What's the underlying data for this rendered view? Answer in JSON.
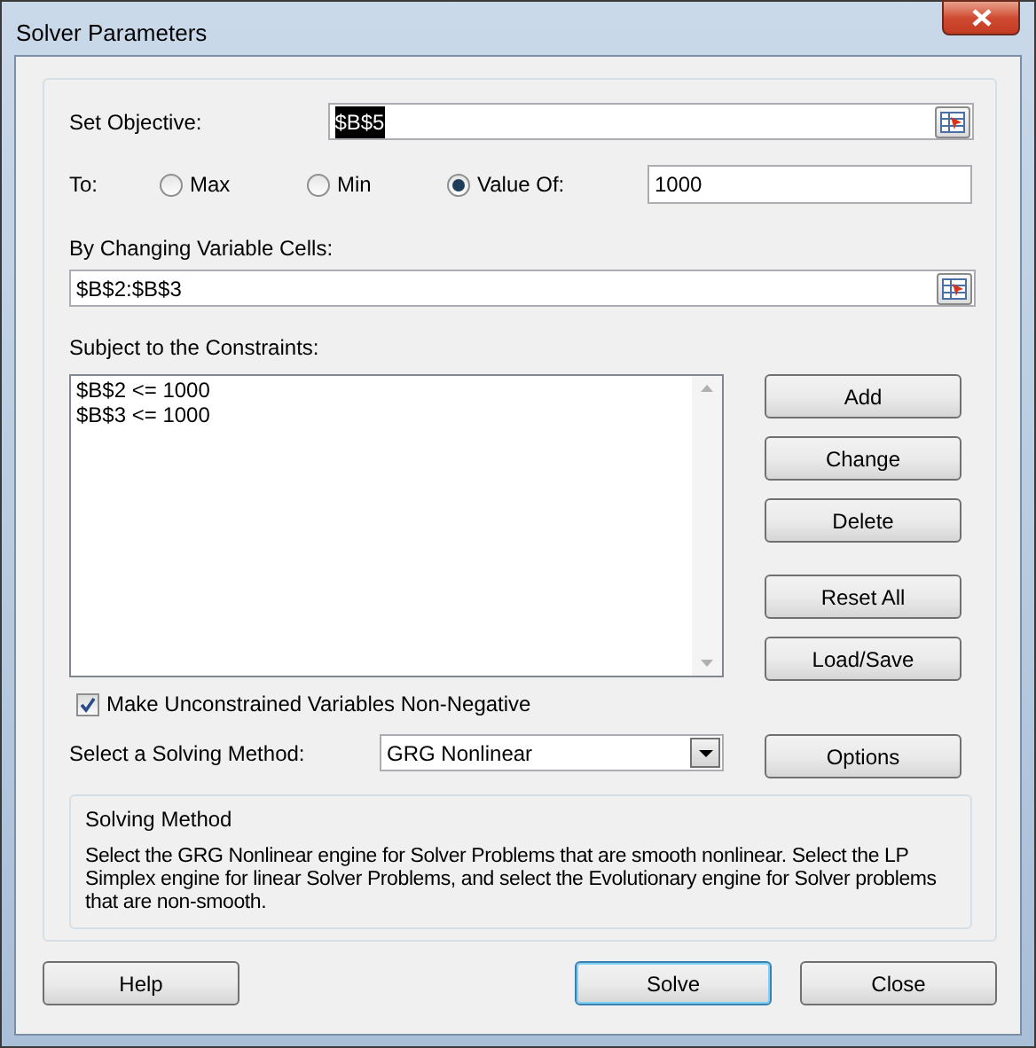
{
  "window": {
    "title": "Solver Parameters"
  },
  "objective": {
    "label": "Set Objective:",
    "value": "$B$5",
    "value_highlighted": true
  },
  "to": {
    "label": "To:",
    "options": [
      {
        "label": "Max",
        "selected": false
      },
      {
        "label": "Min",
        "selected": false
      },
      {
        "label": "Value Of:",
        "selected": true
      }
    ],
    "value": "1000"
  },
  "changing_cells": {
    "label": "By Changing Variable Cells:",
    "value": "$B$2:$B$3"
  },
  "constraints": {
    "label": "Subject to the Constraints:",
    "items": [
      "$B$2 <= 1000",
      "$B$3 <= 1000"
    ]
  },
  "constraint_buttons": [
    [
      "Add",
      "Change",
      "Delete"
    ],
    [
      "Reset All",
      "Load/Save"
    ]
  ],
  "non_negative": {
    "label": "Make Unconstrained Variables Non-Negative",
    "checked": true
  },
  "method": {
    "label": "Select a Solving Method:",
    "value": "GRG Nonlinear"
  },
  "options_button": "Options",
  "description": {
    "title": "Solving Method",
    "text": "Select the GRG Nonlinear engine for Solver Problems that are smooth nonlinear. Select the LP Simplex engine for linear Solver Problems, and select the Evolutionary engine for Solver problems that are non-smooth."
  },
  "footer_buttons": [
    {
      "label": "Help",
      "default": false
    },
    {
      "label": "Solve",
      "default": true
    },
    {
      "label": "Close",
      "default": false
    }
  ]
}
